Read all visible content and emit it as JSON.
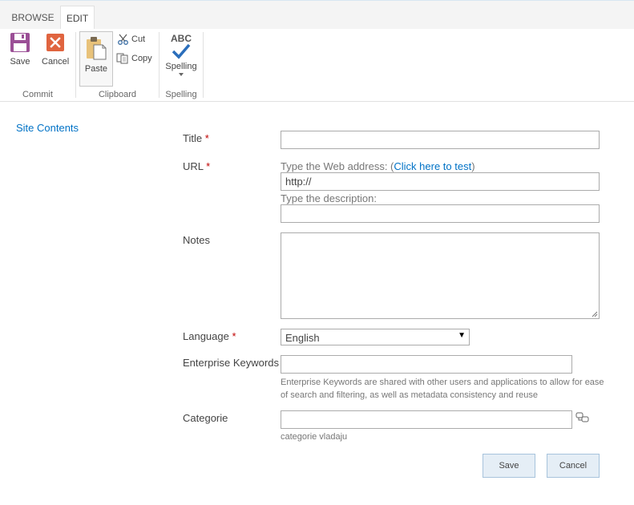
{
  "ribbon": {
    "tabs": [
      {
        "label": "BROWSE"
      },
      {
        "label": "EDIT"
      }
    ],
    "groups": {
      "commit": {
        "label": "Commit",
        "save": "Save",
        "cancel": "Cancel"
      },
      "clipboard": {
        "label": "Clipboard",
        "paste": "Paste",
        "cut": "Cut",
        "copy": "Copy"
      },
      "spelling": {
        "label": "Spelling",
        "spelling": "Spelling",
        "abc": "ABC"
      }
    }
  },
  "leftnav": {
    "site_contents": "Site Contents"
  },
  "form": {
    "title": {
      "label": "Title",
      "required": "*",
      "value": ""
    },
    "url": {
      "label": "URL",
      "required": "*",
      "hint_prefix": "Type the Web address: (",
      "hint_link": "Click here to test",
      "hint_suffix": ")",
      "value": "http://",
      "desc_hint": "Type the description:",
      "desc_value": ""
    },
    "notes": {
      "label": "Notes",
      "value": ""
    },
    "language": {
      "label": "Language",
      "required": "*",
      "selected": "English"
    },
    "keywords": {
      "label": "Enterprise Keywords",
      "value": "",
      "desc": "Enterprise Keywords are shared with other users and applications to allow for ease of search and filtering, as well as metadata consistency and reuse"
    },
    "categorie": {
      "label": "Categorie",
      "value": "",
      "desc": "categorie vladaju"
    }
  },
  "actions": {
    "save": "Save",
    "cancel": "Cancel"
  },
  "colors": {
    "link": "#0072c6",
    "required": "#bf0000",
    "cancel_icon": "#e0643f",
    "save_icon": "#9b4f96",
    "check": "#2a6ebb"
  }
}
